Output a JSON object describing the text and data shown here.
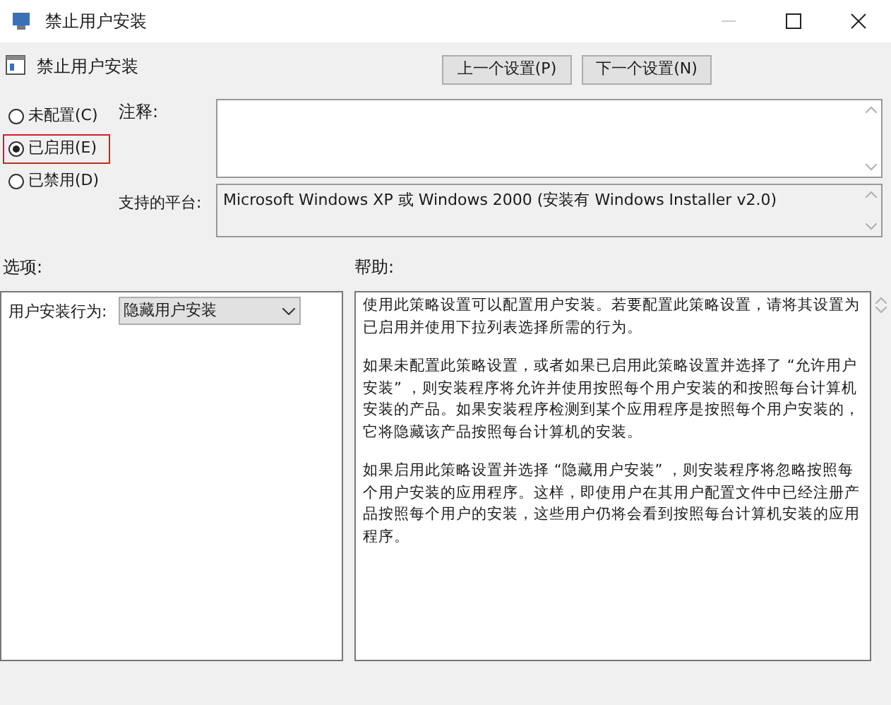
{
  "window": {
    "title": "禁止用户安装"
  },
  "header": {
    "title": "禁止用户安装"
  },
  "nav_buttons": [
    "上一个设置(P)",
    "下一个设置(N)"
  ],
  "radios": [
    {
      "label": "未配置(C)",
      "selected": false
    },
    {
      "label": "已启用(E)",
      "selected": true
    },
    {
      "label": "已禁用(D)",
      "selected": false
    }
  ],
  "comment": {
    "label": "注释:"
  },
  "platform": {
    "label": "支持的平台:",
    "value": "Microsoft Windows XP 或 Windows 2000 (安装有 Windows Installer v2.0)"
  },
  "options": {
    "label": "选项:",
    "field_label": "用户安装行为:",
    "dropdown": "隐藏用户安装"
  },
  "help": {
    "label": "帮助:",
    "paragraphs": [
      "使用此策略设置可以配置用户安装。若要配置此策略设置，请将其设置为已启用并使用下拉列表选择所需的行为。",
      "如果未配置此策略设置，或者如果已启用此策略设置并选择了 “允许用户安装” ，则安装程序将允许并使用按照每个用户安装的和按照每台计算机安装的产品。如果安装程序检测到某个应用程序是按照每个用户安装的，它将隐藏该产品按照每台计算机的安装。",
      "如果启用此策略设置并选择 “隐藏用户安装” ，则安装程序将忽略按照每个用户安装的应用程序。这样，即使用户在其用户配置文件中已经注册产品按照每个用户的安装，这些用户仍将会看到按照每台计算机安装的应用程序。"
    ]
  }
}
